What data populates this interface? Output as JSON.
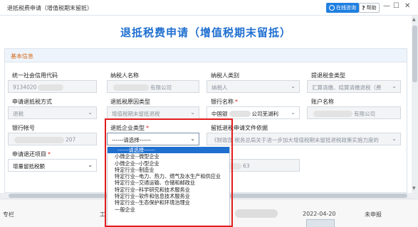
{
  "window": {
    "title": "退抵税费申请（增值税期末留抵）",
    "service_label": "在线咨询",
    "help_label": "帮助"
  },
  "page": {
    "title": "退抵税费申请（增值税期末留抵）",
    "section_title": "基本信息"
  },
  "form": {
    "credit_code": {
      "label": "统一社会信用代码",
      "value": "9134020"
    },
    "taxpayer_name": {
      "label": "纳税人名称",
      "value": "有限公司"
    },
    "taxpayer_type": {
      "label": "纳税人类别",
      "value": "纳税人"
    },
    "refund_type": {
      "label": "提退税金类型",
      "value": "汇算清缴、结算清缴退税（费"
    },
    "apply_method": {
      "label": "申请退抵税方式",
      "value": "退税"
    },
    "reason_type": {
      "label": "退抵税原因类型",
      "value": "增值税期末留抵退税"
    },
    "bank_name": {
      "label": "银行名称",
      "value": "中国银",
      "value_suffix": "公司芜湖利"
    },
    "account_name": {
      "label": "账户名称",
      "value": "有限公司"
    },
    "bank_account": {
      "label": "银行帐号",
      "value": "207"
    },
    "enterprise_type": {
      "label": "退抵企业类型",
      "value": "------请选择------"
    },
    "basis": {
      "label": "留抵退税申请文件依据",
      "value": "《财政部 税务总局关于进一步加大增值税期末留抵退税政策实施力度的"
    },
    "refund_item": {
      "label": "申请退还项目",
      "value": "增量留抵税额"
    },
    "partial_value": "63"
  },
  "dropdown": {
    "options": [
      "------请选择------",
      "小微企业--微型企业",
      "小微企业--小型企业",
      "特定行业--制造业",
      "特定行业--电力、热力、燃气及水生产和供应业",
      "特定行业--交通运输、仓储和邮政业",
      "特定行业--科学研究和技术服务业",
      "特定行业--软件和信息技术服务业",
      "特定行业--生态保护和环境治理业",
      "一般企业"
    ],
    "selected_index": 0
  },
  "background_row": {
    "c1": "专栏",
    "c2": "工",
    "date": "2022-04-20",
    "status": "未申报"
  }
}
